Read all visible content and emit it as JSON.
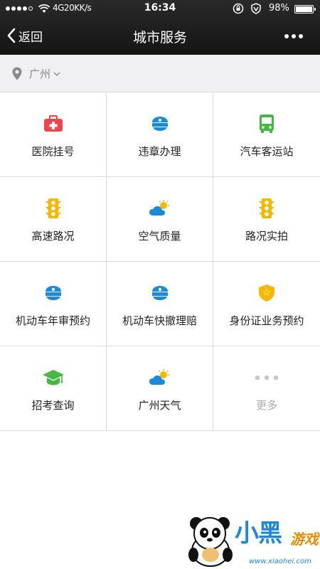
{
  "status_bar": {
    "carrier": "4G20KK/s",
    "time": "16:34",
    "battery": "98%"
  },
  "nav": {
    "back_label": "返回",
    "title": "城市服务"
  },
  "location": {
    "city": "广州"
  },
  "services": [
    {
      "label": "医院挂号",
      "icon": "first-aid-kit-icon",
      "color": "#f0434a"
    },
    {
      "label": "违章办理",
      "icon": "police-cap-icon",
      "color": "#1a8bd8"
    },
    {
      "label": "汽车客运站",
      "icon": "bus-icon",
      "color": "#44b840"
    },
    {
      "label": "高速路况",
      "icon": "traffic-light-icon",
      "color": "#f5b800"
    },
    {
      "label": "空气质量",
      "icon": "weather-cloud-sun-icon",
      "color": "#1a8bd8"
    },
    {
      "label": "路况实拍",
      "icon": "traffic-light-icon",
      "color": "#f5b800"
    },
    {
      "label": "机动车年审预约",
      "icon": "police-cap-icon",
      "color": "#1a8bd8"
    },
    {
      "label": "机动车快撤理赔",
      "icon": "police-cap-icon",
      "color": "#1a8bd8"
    },
    {
      "label": "身份证业务预约",
      "icon": "police-badge-icon",
      "color": "#f5b800"
    },
    {
      "label": "招考查询",
      "icon": "graduation-cap-icon",
      "color": "#44b840"
    },
    {
      "label": "广州天气",
      "icon": "weather-cloud-sun-icon",
      "color": "#1a8bd8"
    },
    {
      "label": "更多",
      "icon": "more-dots-icon",
      "color": "#c8c8c8"
    }
  ],
  "watermark": {
    "brand": "小黑",
    "brand_sub": "游戏",
    "url": "www.xiaohei.com"
  }
}
